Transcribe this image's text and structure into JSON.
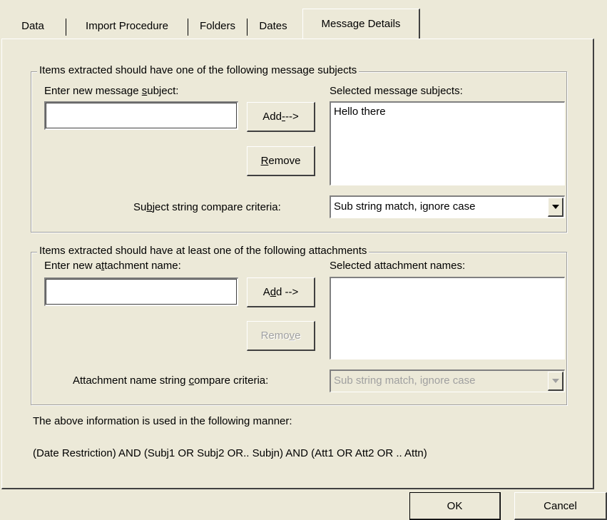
{
  "tabs": [
    {
      "label": "Data",
      "active": false
    },
    {
      "label": "Import Procedure",
      "active": false
    },
    {
      "label": "Folders",
      "active": false
    },
    {
      "label": "Dates",
      "active": false
    },
    {
      "label": "Message Details",
      "active": true
    }
  ],
  "subjects_group": {
    "legend": "Items extracted should have one of the following message subjects",
    "new_label_pre": "Enter new message ",
    "new_label_key": "s",
    "new_label_post": "ubject:",
    "input_value": "",
    "selected_label": "Selected message subjects:",
    "selected_items": [
      "Hello there"
    ],
    "add_pre": "Add ",
    "add_key": "-",
    "add_post": "-->",
    "remove_key": "R",
    "remove_post": "emove",
    "criteria_pre": "Su",
    "criteria_key": "b",
    "criteria_post": "ject string compare criteria:",
    "criteria_value": "Sub string match, ignore case"
  },
  "attachments_group": {
    "legend": "Items extracted should have at least one of the following attachments",
    "new_label_pre": "Enter new a",
    "new_label_key": "t",
    "new_label_post": "tachment name:",
    "input_value": "",
    "selected_label": "Selected attachment names:",
    "selected_items": [],
    "add_pre": "A",
    "add_key": "d",
    "add_post": "d -->",
    "remove_pre": "Remo",
    "remove_key": "v",
    "remove_post": "e",
    "criteria_pre": "Attachment name string ",
    "criteria_key": "c",
    "criteria_post": "ompare criteria:",
    "criteria_value": "Sub string match, ignore case"
  },
  "info_text": "The above information is used in the following manner:",
  "formula_text": "(Date Restriction) AND (Subj1 OR Subj2 OR.. Subjn) AND (Att1 OR Att2 OR .. Attn)",
  "footer": {
    "ok_label": "OK",
    "cancel_label": "Cancel"
  }
}
